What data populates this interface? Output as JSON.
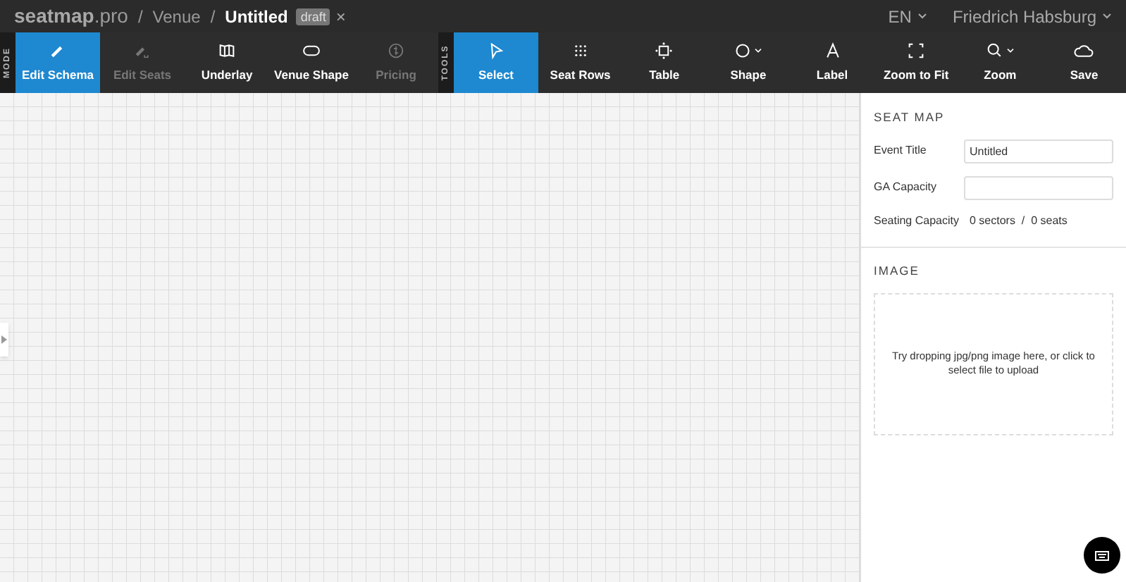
{
  "header": {
    "logo_bold": "seatmap",
    "logo_rest": ".pro",
    "breadcrumbs": [
      "Venue",
      "Untitled"
    ],
    "separator": "/",
    "badge": "draft",
    "close": "×",
    "language": "EN",
    "user": "Friedrich Habsburg"
  },
  "mode": {
    "label": "MODE",
    "items": [
      {
        "label": "Edit Schema",
        "selected": true,
        "disabled": false
      },
      {
        "label": "Edit Seats",
        "selected": false,
        "disabled": true
      },
      {
        "label": "Underlay",
        "selected": false,
        "disabled": false
      },
      {
        "label": "Venue Shape",
        "selected": false,
        "disabled": false
      },
      {
        "label": "Pricing",
        "selected": false,
        "disabled": true
      }
    ]
  },
  "tools": {
    "label": "TOOLS",
    "items": [
      {
        "label": "Select",
        "selected": true,
        "menu": false
      },
      {
        "label": "Seat Rows",
        "selected": false,
        "menu": false
      },
      {
        "label": "Table",
        "selected": false,
        "menu": false
      },
      {
        "label": "Shape",
        "selected": false,
        "menu": true
      },
      {
        "label": "Label",
        "selected": false,
        "menu": false
      },
      {
        "label": "Zoom to Fit",
        "selected": false,
        "menu": false
      },
      {
        "label": "Zoom",
        "selected": false,
        "menu": true
      },
      {
        "label": "Save",
        "selected": false,
        "menu": false
      }
    ]
  },
  "panel": {
    "seat_map": {
      "title": "SEAT MAP",
      "fields": [
        {
          "label": "Event Title",
          "value": "Untitled"
        },
        {
          "label": "GA Capacity"
        }
      ],
      "seating_capacity": {
        "label": "Seating Capacity",
        "sectors": "0 sectors",
        "separator": "/",
        "seats": "0 seats"
      }
    },
    "image": {
      "title": "IMAGE",
      "drop_text": "Try dropping jpg/png image here, or click to select file to upload"
    }
  }
}
